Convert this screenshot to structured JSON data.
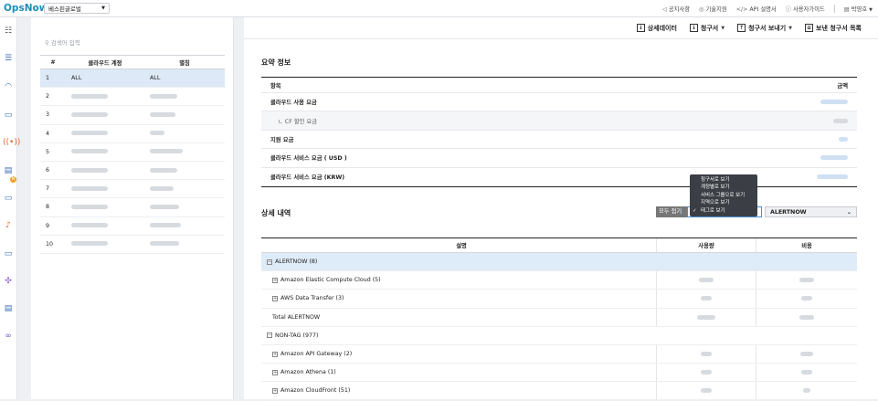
{
  "app": {
    "logo": "OpsNow",
    "company": "베스핀글로벌"
  },
  "topnav": [
    {
      "icon": "megaphone-icon",
      "glyph": "📢",
      "label": "공지사항"
    },
    {
      "icon": "globe-icon",
      "glyph": "◎",
      "label": "기술지원"
    },
    {
      "icon": "code-icon",
      "glyph": "</>",
      "label": "API 설명서"
    },
    {
      "icon": "help-icon",
      "glyph": "?",
      "label": "사용자가이드"
    },
    {
      "icon": "user-icon",
      "glyph": "▤",
      "label": "박영호"
    }
  ],
  "left": {
    "search_placeholder": "검색어 입력",
    "columns": [
      "#",
      "클라우드 계정",
      "별칭"
    ],
    "rows": [
      {
        "num": "1",
        "account": "ALL",
        "alias": "ALL"
      },
      {
        "num": "2"
      },
      {
        "num": "3"
      },
      {
        "num": "4"
      },
      {
        "num": "5"
      },
      {
        "num": "6"
      },
      {
        "num": "7"
      },
      {
        "num": "8"
      },
      {
        "num": "9"
      },
      {
        "num": "10"
      }
    ]
  },
  "toolbar": {
    "detail": "상세데이터",
    "invoice": "청구서",
    "send": "청구서 보내기",
    "sent_list": "보낸 청구서 목록"
  },
  "summary": {
    "title": "요약 정보",
    "col_item": "항목",
    "col_amount": "금액",
    "rows": [
      "클라우드 사용 요금",
      "ㄴ CF 할인 요금",
      "지원 요금",
      "클라우드 서비스 요금 ( USD )",
      "클라우드 서비스 요금 (KRW)"
    ]
  },
  "detail": {
    "title": "상세 내역",
    "collapse_all": "모두 접기",
    "tag_select": "ALERTNOW",
    "col_desc": "설명",
    "col_usage": "사용량",
    "col_cost": "비용",
    "rows": [
      {
        "label": "ALERTNOW (8)",
        "type": "group"
      },
      {
        "label": "Amazon Elastic Compute Cloud (5)",
        "type": "item"
      },
      {
        "label": "AWS Data Transfer (3)",
        "type": "item"
      },
      {
        "label": "Total ALERTNOW",
        "type": "total"
      },
      {
        "label": "NON-TAG (977)",
        "type": "group2"
      },
      {
        "label": "Amazon API Gateway (2)",
        "type": "item"
      },
      {
        "label": "Amazon Athena (1)",
        "type": "item"
      },
      {
        "label": "Amazon CloudFront (51)",
        "type": "item"
      }
    ]
  },
  "view_menu": [
    "청구서로 보기",
    "계정별로 보기",
    "서비스 그룹으로 보기",
    "지역으로 보기",
    "태그로 보기"
  ],
  "view_menu_checked": 4,
  "sidebar_badge": "N",
  "colors": {
    "brand": "#1a8fb7",
    "accent": "#f2a22c",
    "selected_row": "#dde9f6"
  }
}
